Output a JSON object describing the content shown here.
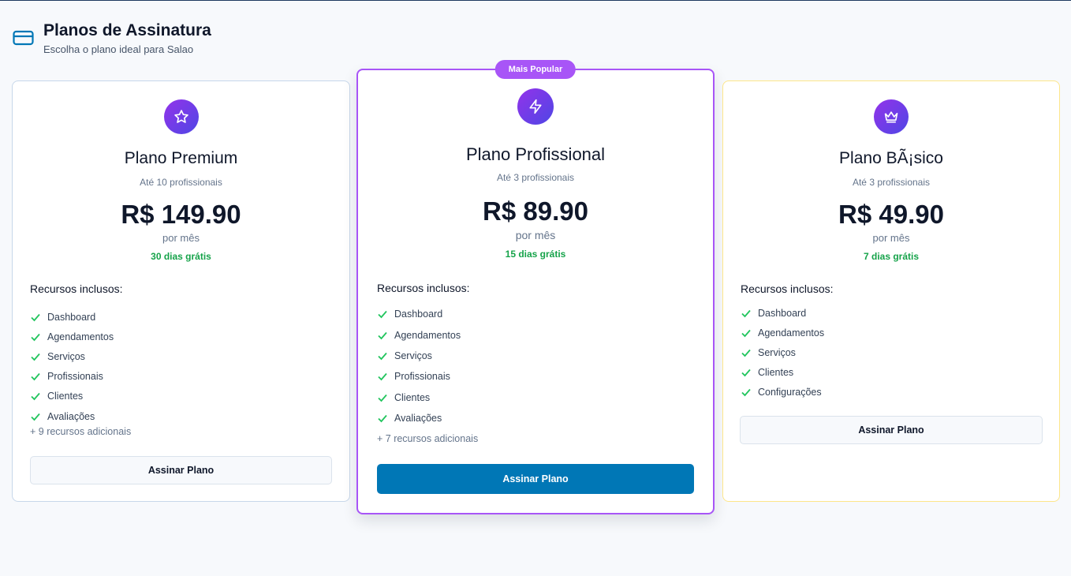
{
  "header": {
    "icon": "credit-card-icon",
    "title": "Planos de Assinatura",
    "subtitle": "Escolha o plano ideal para Salao"
  },
  "colors": {
    "accent": "#0077b6",
    "popular": "#a855f7",
    "trial": "#16a34a"
  },
  "plans": [
    {
      "icon": "star-icon",
      "name": "Plano Premium",
      "limit": "Até 10 profissionais",
      "price": "R$ 149.90",
      "period": "por mês",
      "trial": "30 dias grátis",
      "features_title": "Recursos inclusos:",
      "features": [
        "Dashboard",
        "Agendamentos",
        "Serviços",
        "Profissionais",
        "Clientes",
        "Avaliações"
      ],
      "extra": "+ 9 recursos adicionais",
      "button": "Assinar Plano"
    },
    {
      "badge": "Mais Popular",
      "icon": "zap-icon",
      "name": "Plano Profissional",
      "limit": "Até 3 profissionais",
      "price": "R$ 89.90",
      "period": "por mês",
      "trial": "15 dias grátis",
      "features_title": "Recursos inclusos:",
      "features": [
        "Dashboard",
        "Agendamentos",
        "Serviços",
        "Profissionais",
        "Clientes",
        "Avaliações"
      ],
      "extra": "+ 7 recursos adicionais",
      "button": "Assinar Plano"
    },
    {
      "icon": "crown-icon",
      "name": "Plano BÃ¡sico",
      "limit": "Até 3 profissionais",
      "price": "R$ 49.90",
      "period": "por mês",
      "trial": "7 dias grátis",
      "features_title": "Recursos inclusos:",
      "features": [
        "Dashboard",
        "Agendamentos",
        "Serviços",
        "Clientes",
        "Configurações"
      ],
      "button": "Assinar Plano"
    }
  ]
}
